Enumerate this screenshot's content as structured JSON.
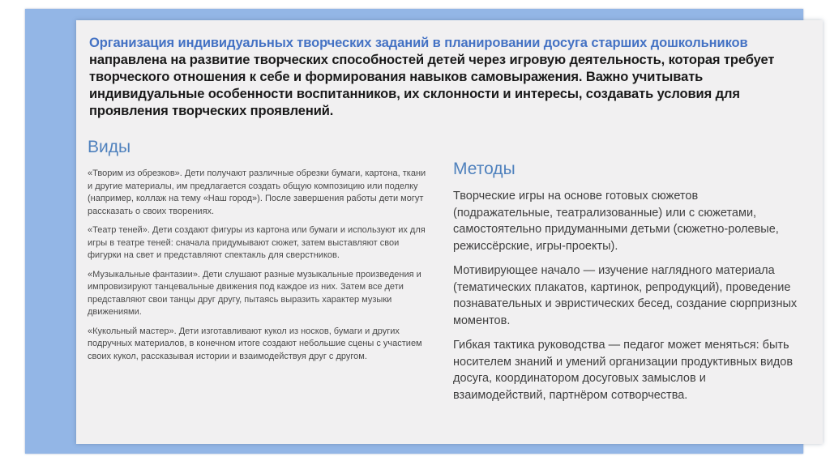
{
  "header": {
    "accent_text": "Организация индивидуальных творческих заданий в планировании досуга старших дошкольников",
    "body_text": " направлена на развитие творческих способностей детей через игровую деятельность, которая требует творческого отношения к себе и формирования навыков самовыражения. Важно учитывать индивидуальные особенности воспитанников, их склонности и интересы, создавать условия для проявления творческих проявлений."
  },
  "vidy": {
    "title": "Виды",
    "items": [
      "«Творим из обрезков». Дети получают различные обрезки бумаги, картона, ткани и другие материалы, им предлагается создать общую композицию или поделку (например, коллаж на тему «Наш город»). После завершения работы дети могут рассказать о своих творениях.",
      "«Театр теней». Дети создают фигуры из картона или бумаги и используют их для игры в театре теней: сначала придумывают сюжет, затем выставляют свои фигурки на свет и представляют спектакль для сверстников.",
      "«Музыкальные фантазии». Дети слушают разные музыкальные произведения и импровизируют танцевальные движения под каждое из них. Затем все дети представляют свои танцы друг другу, пытаясь выразить характер музыки движениями.",
      "«Кукольный мастер». Дети изготавливают кукол из носков, бумаги и других подручных материалов, в конечном итоге создают небольшие сцены с участием своих кукол, рассказывая истории и взаимодействуя друг с другом."
    ]
  },
  "metody": {
    "title": "Методы",
    "items": [
      "Творческие игры на основе готовых сюжетов (подражательные, театрализованные) или с сюжетами, самостоятельно придуманными детьми (сюжетно-ролевые, режиссёрские, игры-проекты).",
      "Мотивирующее начало — изучение наглядного материала (тематических плакатов, картинок, репродукций), проведение познавательных и эвристических бесед, создание сюрпризных моментов.",
      "Гибкая тактика руководства — педагог может меняться: быть носителем знаний и умений организации продуктивных видов досуга, координатором досуговых замыслов и взаимодействий, партнёром сотворчества."
    ]
  },
  "colors": {
    "frame": "#93b6e6",
    "panel": "#f1f0f1",
    "accent": "#4472c4",
    "section_title": "#4f81bd"
  }
}
